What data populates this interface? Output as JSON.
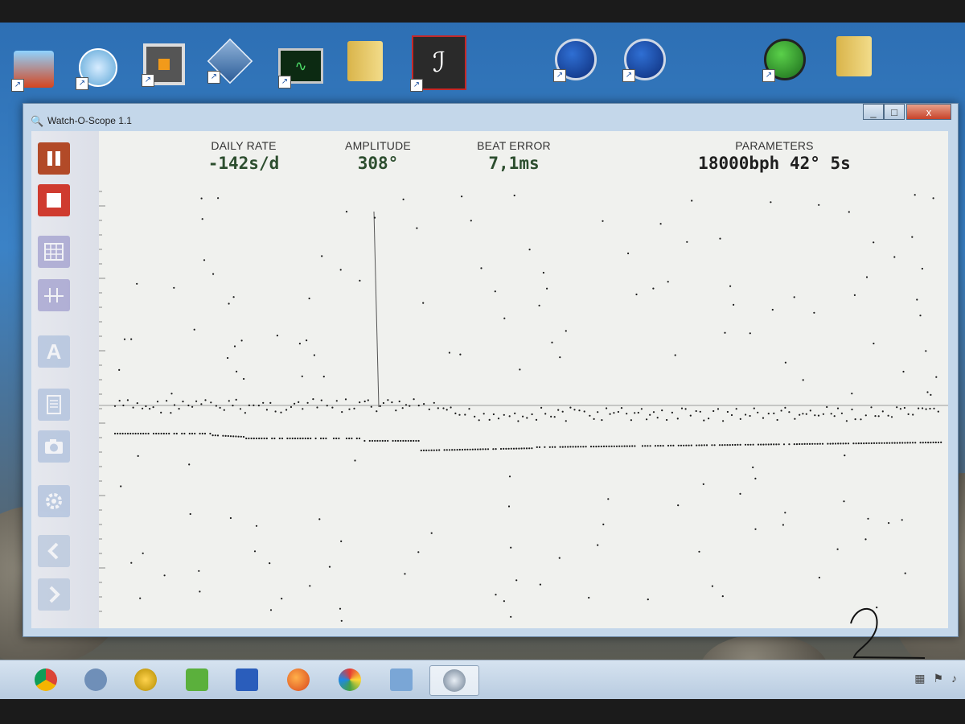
{
  "window": {
    "title": "Watch-O-Scope 1.1",
    "close_glyph": "x",
    "minimize_glyph": "_",
    "maximize_glyph": "□"
  },
  "readouts": {
    "daily_rate": {
      "label": "DAILY RATE",
      "value": "-142s/d"
    },
    "amplitude": {
      "label": "AMPLITUDE",
      "value": "308°"
    },
    "beat_error": {
      "label": "BEAT ERROR",
      "value": "7,1ms"
    },
    "parameters": {
      "label": "PARAMETERS",
      "value": "18000bph 42° 5s"
    }
  },
  "toolbar": {
    "buttons": [
      {
        "name": "pause-button",
        "icon": "pause-icon",
        "state": "active"
      },
      {
        "name": "stop-button",
        "icon": "stop-icon",
        "state": "active"
      },
      {
        "name": "grid-button",
        "icon": "grid-icon",
        "state": "disabled"
      },
      {
        "name": "trace-button",
        "icon": "trace-icon",
        "state": "disabled"
      },
      {
        "name": "amplitude-button",
        "icon": "letter-a-icon",
        "state": "disabled",
        "glyph": "A"
      },
      {
        "name": "report-button",
        "icon": "document-icon",
        "state": "disabled"
      },
      {
        "name": "snapshot-button",
        "icon": "camera-icon",
        "state": "disabled"
      },
      {
        "name": "settings-button",
        "icon": "gear-icon",
        "state": "disabled"
      },
      {
        "name": "previous-button",
        "icon": "chevron-left-icon",
        "state": "disabled"
      },
      {
        "name": "next-button",
        "icon": "chevron-right-icon",
        "state": "disabled"
      }
    ]
  },
  "desktop": {
    "icons": [
      "disk-utility-icon",
      "network-icon",
      "frame-app-icon",
      "virtual-box-icon",
      "monitor-app-icon",
      "folder-icon",
      "pdf-reader-icon",
      "scope-app-icon",
      "scope-app-icon",
      "globe-app-icon",
      "folder-globe-icon"
    ]
  },
  "taskbar": {
    "items": [
      "chrome-icon",
      "network-icon",
      "media-icon",
      "torrent-icon",
      "save-icon",
      "firefox-icon",
      "paint-icon",
      "network-share-icon",
      "watch-o-scope-icon"
    ]
  },
  "colors": {
    "window_frame": "#c4d7ea",
    "plot_background": "#f0f1ee",
    "readout_value": "#2d4e2f",
    "pause_button": "#b24a28",
    "stop_button": "#cf3b2f",
    "trace_dots": "#1a1a1a"
  }
}
